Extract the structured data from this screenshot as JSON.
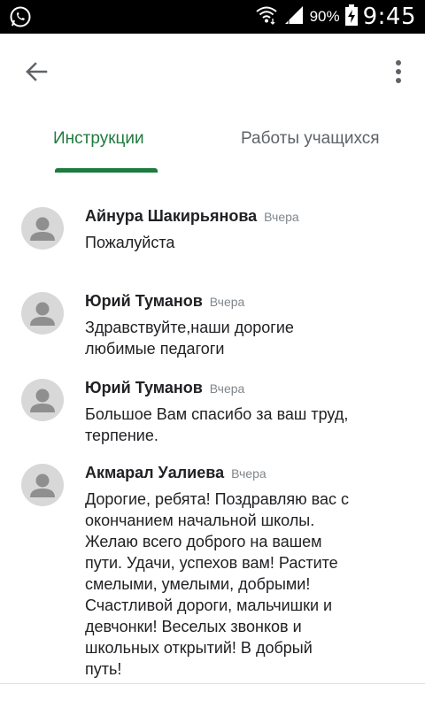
{
  "status_bar": {
    "battery": "90%",
    "time": "9:45",
    "icons": [
      "whatsapp-icon",
      "wifi-icon",
      "signal-icon",
      "battery-charging-icon"
    ]
  },
  "app_bar": {
    "icons": [
      "back-arrow-icon",
      "more-vert-icon"
    ]
  },
  "tabs": [
    {
      "label": "Инструкции",
      "active": true
    },
    {
      "label": "Работы учащихся",
      "active": false
    }
  ],
  "accent_color": "#1e7b3e",
  "comments": [
    {
      "author": "Айнура Шакирьянова",
      "when": "Вчера",
      "text": "Пожалуйста"
    },
    {
      "author": "Юрий Туманов",
      "when": "Вчера",
      "text": "Здравствуйте,наши дорогие\nлюбимые педагоги"
    },
    {
      "author": "Юрий Туманов",
      "when": "Вчера",
      "text": "Большое Вам спасибо за ваш труд,\nтерпение."
    },
    {
      "author": "Акмарал Уалиева",
      "when": "Вчера",
      "text": "Дорогие, ребята! Поздравляю вас с\nокончанием начальной школы.\nЖелаю всего доброго на вашем\nпути. Удачи, успехов вам! Растите\nсмелыми, умелыми, добрыми!\nСчастливой дороги, мальчишки и\nдевчонки! Веселых звонков и\nшкольных открытий! В добрый\nпуть!"
    }
  ]
}
